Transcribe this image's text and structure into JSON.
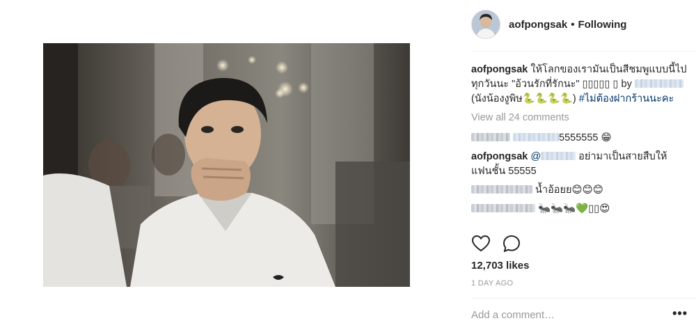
{
  "post": {
    "username": "aofpongsak",
    "separator": "•",
    "follow_label": "Following",
    "caption": {
      "text_before_mention": "ให้โลกของเรามันเป็นสีชมพูแบบนี้ไปทุกวันนะ \"อ้วนรักที่รักนะ\" ▯▯▯▯▯ ▯ by",
      "text_after_mention": "(นังน้องงูพิษ🐍🐍🐍🐍)",
      "hashtag": "#ไม่ต้องฝากร้านนะคะ"
    },
    "view_all_label": "View all 24 comments",
    "comments": [
      {
        "text": "5555555 😁"
      },
      {
        "username": "aofpongsak",
        "mention": "@",
        "text": "อย่ามาเป็นสายสืบให้แฟนชั้น 55555"
      },
      {
        "text": "น้ำอ้อยย😊😊😊"
      },
      {
        "text": "🐜🐜🐜💚▯▯😍"
      }
    ],
    "likes": "12,703 likes",
    "timestamp": "1 DAY AGO",
    "add_comment_placeholder": "Add a comment…",
    "more_label": "•••"
  },
  "icons": {
    "like": "heart-icon",
    "comment": "comment-bubble-icon",
    "more": "more-options-icon"
  },
  "colors": {
    "text": "#262626",
    "muted": "#999999",
    "hashtag": "#003569",
    "divider": "#efefef"
  }
}
